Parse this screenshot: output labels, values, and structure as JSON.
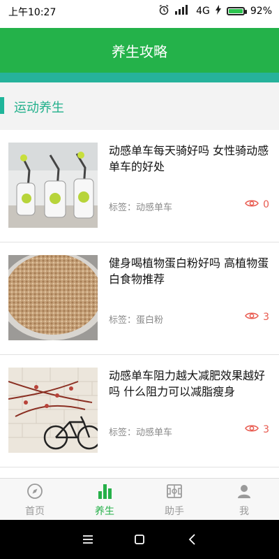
{
  "status_bar": {
    "time": "上午10:27",
    "network": "4G",
    "battery": "92%",
    "battery_level": 0.92
  },
  "header": {
    "title": "养生攻略"
  },
  "section": {
    "title": "运动养生"
  },
  "articles": [
    {
      "title": "动感单车每天骑好吗 女性骑动感单车的好处",
      "tag": "标签：动感单车",
      "views": "0",
      "thumb_icon": "exercise-bikes-photo"
    },
    {
      "title": "健身喝植物蛋白粉好吗 高植物蛋白食物推荐",
      "tag": "标签：蛋白粉",
      "views": "3",
      "thumb_icon": "grains-photo"
    },
    {
      "title": "动感单车阻力越大减肥效果越好吗 什么阻力可以减脂瘦身",
      "tag": "标签：动感单车",
      "views": "3",
      "thumb_icon": "bicycle-photo"
    }
  ],
  "tabs": [
    {
      "label": "首页",
      "icon": "compass-icon"
    },
    {
      "label": "养生",
      "icon": "bar-chart-icon"
    },
    {
      "label": "助手",
      "icon": "assistant-board-icon"
    },
    {
      "label": "我",
      "icon": "user-icon"
    }
  ],
  "colors": {
    "primary": "#24b24a",
    "accent": "#26b29b",
    "views": "#e85a4f",
    "active_tab": "#26b049"
  }
}
